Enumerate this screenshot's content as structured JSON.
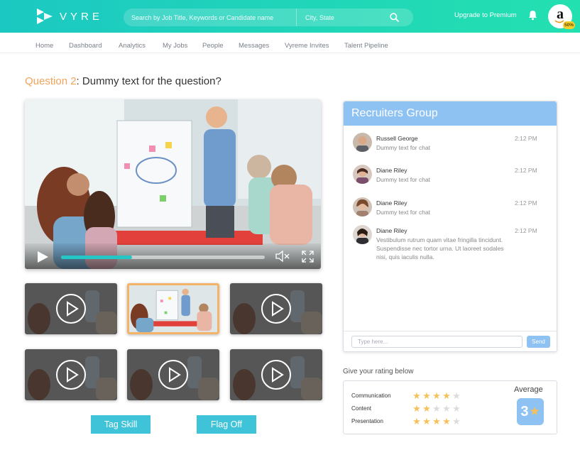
{
  "header": {
    "logo_text": "VYRE",
    "search_placeholder": "Search by Job Title, Keywords or Candidate name",
    "city_placeholder": "City, State",
    "upgrade_label": "Upgrade to Premium",
    "profile_letter": "a",
    "profile_badge": "50%"
  },
  "nav": {
    "items": [
      "Home",
      "Dashboard",
      "Analytics",
      "My Jobs",
      "People",
      "Messages",
      "Vyreme Invites",
      "Talent Pipeline"
    ]
  },
  "question": {
    "label": "Question 2",
    "separator": ":",
    "text": "Dummy text for the question?"
  },
  "player": {
    "progress_fraction": 0.35
  },
  "buttons": {
    "tag_skill": "Tag Skill",
    "flag_off": "Flag Off"
  },
  "chat": {
    "title": "Recruiters Group",
    "messages": [
      {
        "name": "Russell George",
        "text": "Dummy text for chat",
        "time": "2:12 PM"
      },
      {
        "name": "Diane Riley",
        "text": "Dummy text for chat",
        "time": "2:12 PM"
      },
      {
        "name": "Diane Riley",
        "text": "Dummy text for chat",
        "time": "2:12 PM"
      },
      {
        "name": "Diane Riley",
        "text": "Vestibulum rutrum quam vitae fringilla tincidunt. Suspendisse nec tortor urna. Ut laoreet sodales nisi, quis iaculis nulla.",
        "time": "2:12 PM"
      }
    ],
    "input_placeholder": "Type here...",
    "send_label": "Send"
  },
  "rating": {
    "title": "Give your rating below",
    "rows": [
      {
        "label": "Communication",
        "stars": 4,
        "max": 5
      },
      {
        "label": "Content",
        "stars": 2,
        "max": 5
      },
      {
        "label": "Presentation",
        "stars": 4,
        "max": 5
      }
    ],
    "average_label": "Average",
    "average_value": "3"
  },
  "colors": {
    "header_gradient_start": "#1cc8c2",
    "header_gradient_end": "#23e0b0",
    "accent": "#3fc3d8",
    "question_label": "#f0a35a",
    "chat_header": "#8ec2f2",
    "star": "#f6c15a"
  },
  "icons": {
    "search": "search-icon",
    "bell": "bell-icon",
    "play": "play-icon",
    "mute": "mute-icon",
    "fullscreen": "fullscreen-icon"
  }
}
